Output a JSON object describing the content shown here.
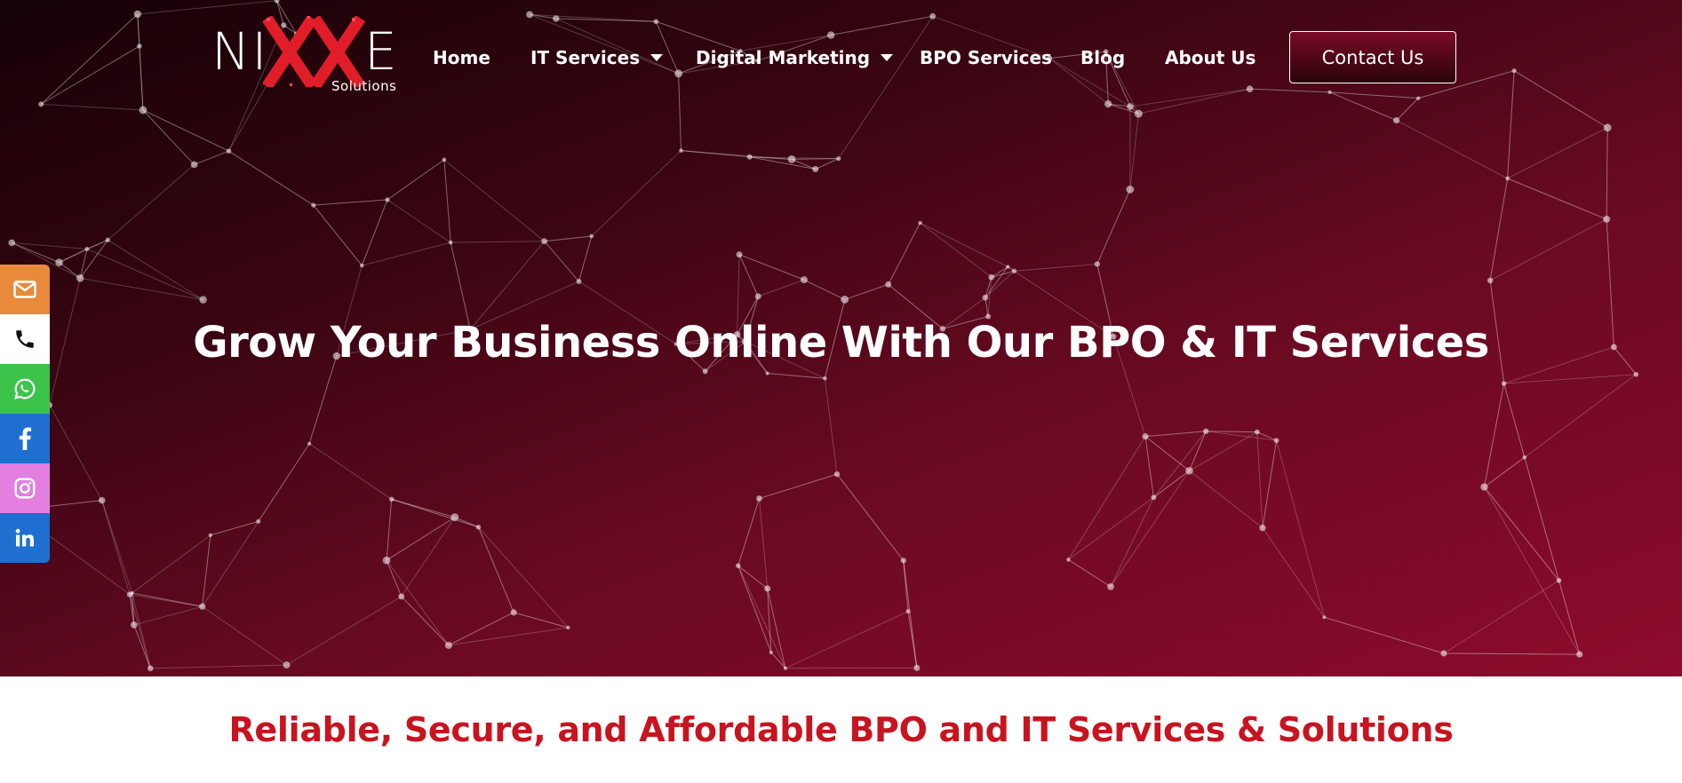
{
  "brand": {
    "logo_left": "NI",
    "logo_right": "E",
    "logo_sub": "Solutions",
    "accent_color": "#e11d2a"
  },
  "nav": {
    "items": [
      {
        "label": "Home",
        "has_dropdown": false
      },
      {
        "label": "IT Services",
        "has_dropdown": true
      },
      {
        "label": "Digital Marketing",
        "has_dropdown": true
      },
      {
        "label": "BPO Services",
        "has_dropdown": false
      },
      {
        "label": "Blog",
        "has_dropdown": false
      },
      {
        "label": "About Us",
        "has_dropdown": false
      }
    ],
    "cta_label": "Contact Us"
  },
  "hero": {
    "title": "Grow Your Business Online With Our BPO & IT Services",
    "gradient": [
      "#150206",
      "#3a0512",
      "#6a0a22",
      "#8d0b2c"
    ]
  },
  "social_bar": [
    {
      "icon": "mail-icon",
      "color": "#e88a3a"
    },
    {
      "icon": "phone-icon",
      "color": "#ffffff"
    },
    {
      "icon": "whatsapp-icon",
      "color": "#3cc34a"
    },
    {
      "icon": "facebook-icon",
      "color": "#1e6fd0"
    },
    {
      "icon": "instagram-icon",
      "color": "#e37fe0"
    },
    {
      "icon": "linkedin-icon",
      "color": "#1e6fd0"
    }
  ],
  "section": {
    "subtitle": "Reliable, Secure, and Affordable BPO and IT Services & Solutions",
    "subtitle_color": "#c8141f"
  }
}
